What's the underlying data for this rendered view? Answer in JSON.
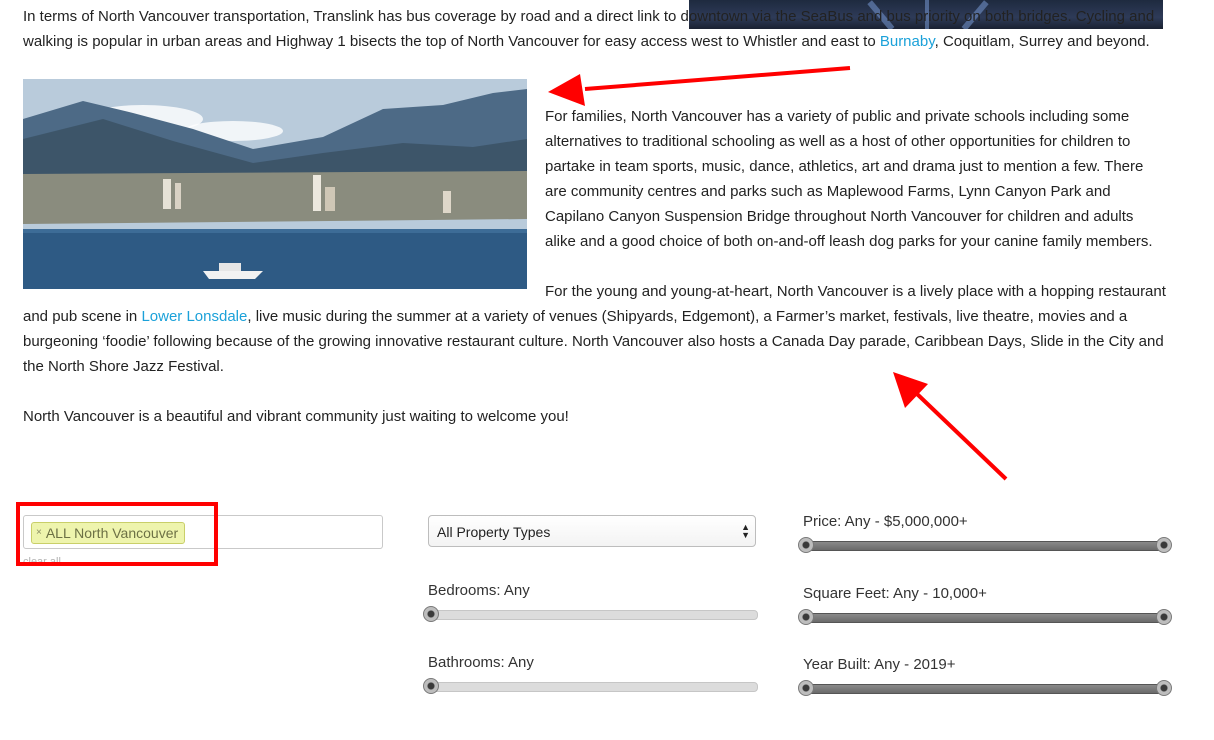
{
  "article": {
    "transport_text_1": "In terms of North Vancouver transportation, Translink has  bus coverage by road and a direct link to downtown via the SeaBus and bus priority on both bridges. Cycling and walking is popular in urban areas and Highway 1 bisects the top of North Vancouver for easy access west to Whistler and east to ",
    "transport_link": "Burnaby",
    "transport_text_2": ", Coquitlam, Surrey and beyond.",
    "families_text": "For families, North Vancouver has a variety of public and private schools including some alternatives to traditional schooling as well as a host of other opportunities for children to partake in team sports, music, dance, athletics, art and drama just to mention a few. There are community centres and parks such as Maplewood Farms, Lynn Canyon Park and Capilano Canyon Suspension Bridge throughout North Vancouver for children and adults alike and a good choice of both on-and-off leash dog parks for your canine family members.",
    "young_text_1": "For the young and young-at-heart, North Vancouver is a lively place with a hopping restaurant and pub scene in ",
    "young_link": "Lower Lonsdale",
    "young_text_2": ", live music during the summer at a variety of venues (Shipyards, Edgemont), a Farmer’s market, festivals, live theatre, movies and a burgeoning ‘foodie’ following because of the growing innovative restaurant culture. North Vancouver also hosts a Canada Day parade, Caribbean Days, Slide in the City and the North Shore Jazz Festival.",
    "welcome_text": "North Vancouver is a beautiful and vibrant community just waiting to welcome you!"
  },
  "search": {
    "tag_remove": "×",
    "tag_label": "ALL North Vancouver",
    "clear_all": "clear all"
  },
  "filters": {
    "property_type": "All Property Types",
    "bedrooms": "Bedrooms: Any",
    "bathrooms": "Bathrooms: Any",
    "price": "Price:  Any - $5,000,000+",
    "square_feet": "Square Feet:  Any - 10,000+",
    "year_built": "Year Built:  Any - 2019+"
  },
  "colors": {
    "link": "#1ba1d9",
    "annotation": "#ff0000",
    "tag_bg": "#eef4ad"
  }
}
